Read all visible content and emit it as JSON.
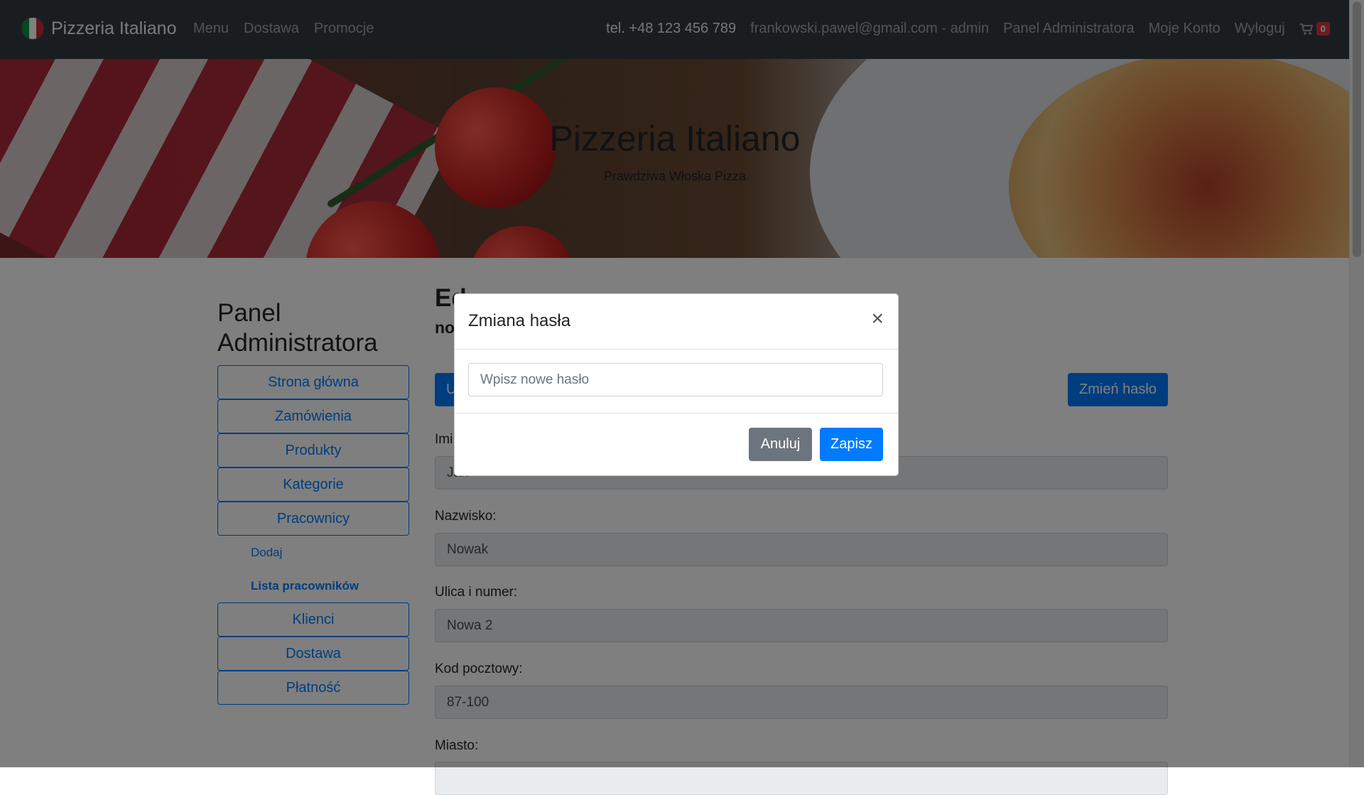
{
  "navbar": {
    "brand": "Pizzeria Italiano",
    "links_left": [
      "Menu",
      "Dostawa",
      "Promocje"
    ],
    "phone": "tel. +48 123 456 789",
    "user": "frankowski.pawel@gmail.com - admin",
    "links_right": [
      "Panel Administratora",
      "Moje Konto",
      "Wyloguj"
    ],
    "cart_count": "0",
    "flag_colors": [
      "#009246",
      "#ffffff",
      "#ce2b37"
    ]
  },
  "hero": {
    "title": "Pizzeria Italiano",
    "subtitle": "Prawdziwa Włoska Pizza"
  },
  "sidebar": {
    "title": "Panel Administratora",
    "items": [
      {
        "label": "Strona główna",
        "type": "button"
      },
      {
        "label": "Zamówienia",
        "type": "button"
      },
      {
        "label": "Produkty",
        "type": "button"
      },
      {
        "label": "Kategorie",
        "type": "button"
      },
      {
        "label": "Pracownicy",
        "type": "button"
      },
      {
        "label": "Dodaj",
        "type": "sub"
      },
      {
        "label": "Lista pracowników",
        "type": "sub-active"
      },
      {
        "label": "Klienci",
        "type": "button"
      },
      {
        "label": "Dostawa",
        "type": "button"
      },
      {
        "label": "Płatność",
        "type": "button"
      }
    ]
  },
  "main": {
    "heading_partial": "Ed",
    "subheading_partial": "no",
    "button_left_partial": "U",
    "change_password_button": "Zmień hasło",
    "fields": [
      {
        "label": "Imi",
        "value": "Jan"
      },
      {
        "label": "Nazwisko:",
        "value": "Nowak"
      },
      {
        "label": "Ulica i numer:",
        "value": "Nowa 2"
      },
      {
        "label": "Kod pocztowy:",
        "value": "87-100"
      },
      {
        "label": "Miasto:",
        "value": ""
      }
    ]
  },
  "modal": {
    "title": "Zmiana hasła",
    "close_symbol": "×",
    "input_placeholder": "Wpisz nowe hasło",
    "cancel_label": "Anuluj",
    "save_label": "Zapisz"
  },
  "colors": {
    "navbar_bg": "#343a40",
    "primary": "#007bff",
    "secondary": "#6c757d",
    "badge": "#dc3545"
  }
}
